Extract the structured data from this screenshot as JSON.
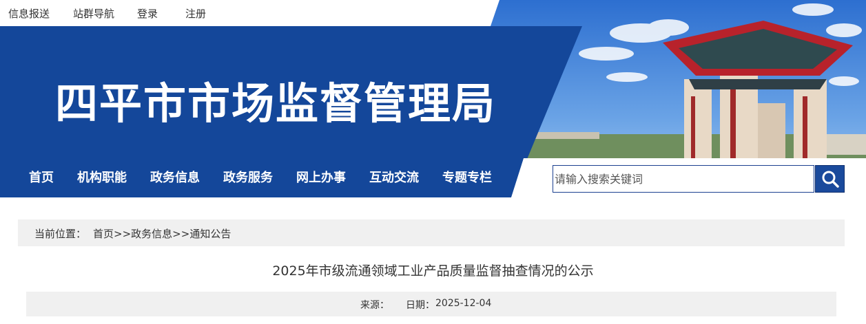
{
  "top_links": [
    "信息报送",
    "站群导航",
    "登录",
    "注册"
  ],
  "site_title": "四平市市场监督管理局",
  "nav_items": [
    "首页",
    "机构职能",
    "政务信息",
    "政务服务",
    "网上办事",
    "互动交流",
    "专题专栏"
  ],
  "search": {
    "placeholder": "请输入搜索关键词"
  },
  "breadcrumb": {
    "label": "当前位置：",
    "items": [
      "首页",
      "政务信息",
      "通知公告"
    ],
    "separator": ">>"
  },
  "article": {
    "title": "2025年市级流通领域工业产品质量监督抽查情况的公示",
    "source_label": "来源：",
    "source_value": "",
    "date_label": "日期：",
    "date_value": "2025-12-04"
  },
  "colors": {
    "brand_blue": "#14479a",
    "search_button": "#1a4a9c",
    "breadcrumb_bg": "#f0f0f0"
  },
  "icons": {
    "search_button": "search-icon"
  }
}
